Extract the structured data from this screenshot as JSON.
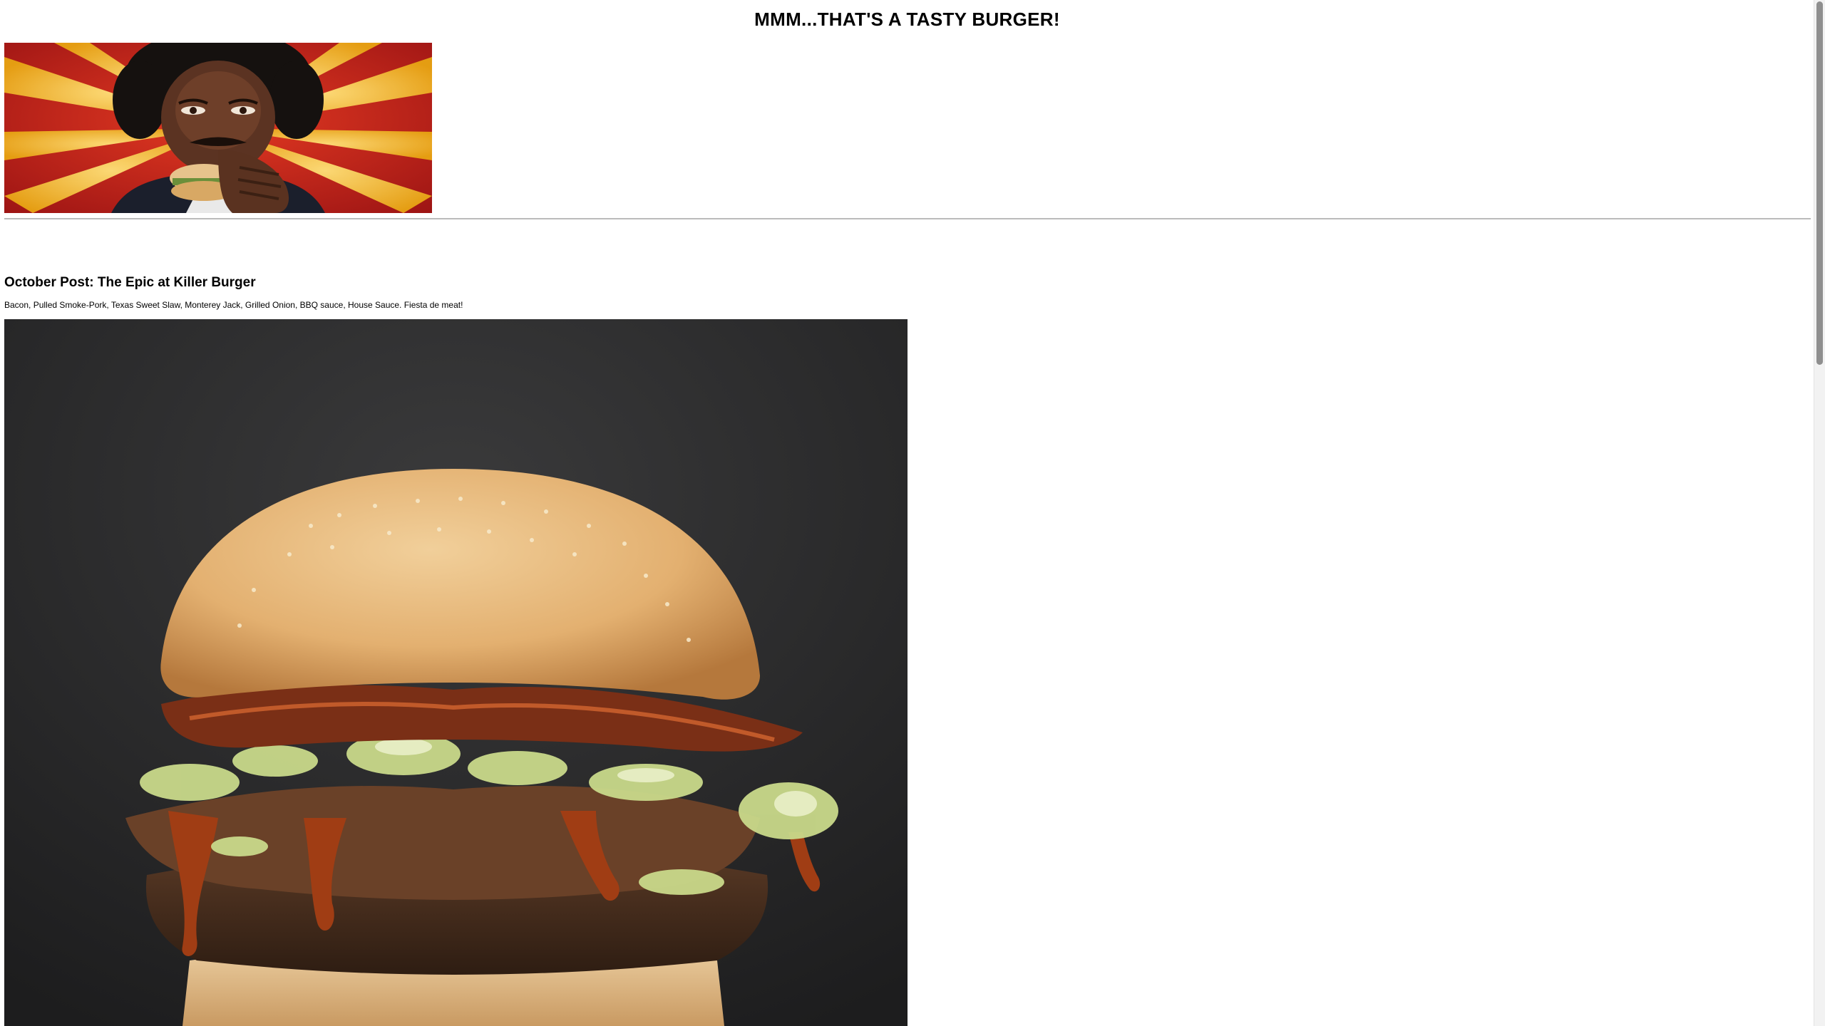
{
  "header": {
    "title": "MMM...THAT'S A TASTY BURGER!"
  },
  "hero": {
    "image_name": "man-eating-burger-sunburst-illustration"
  },
  "post": {
    "title": "October Post: The Epic at Killer Burger",
    "description": "Bacon, Pulled Smoke-Pork, Texas Sweet Slaw, Monterey Jack, Grilled Onion, BBQ sauce, House Sauce. Fiesta de meat!",
    "image_name": "bacon-pulled-pork-burger-photo"
  },
  "colors": {
    "banner_red": "#c8201e",
    "banner_yellow": "#f2b81a",
    "photo_bg": "#2a2a2b",
    "bun": "#e3b070",
    "sauce": "#9a3b12",
    "slaw": "#c9d98a"
  }
}
